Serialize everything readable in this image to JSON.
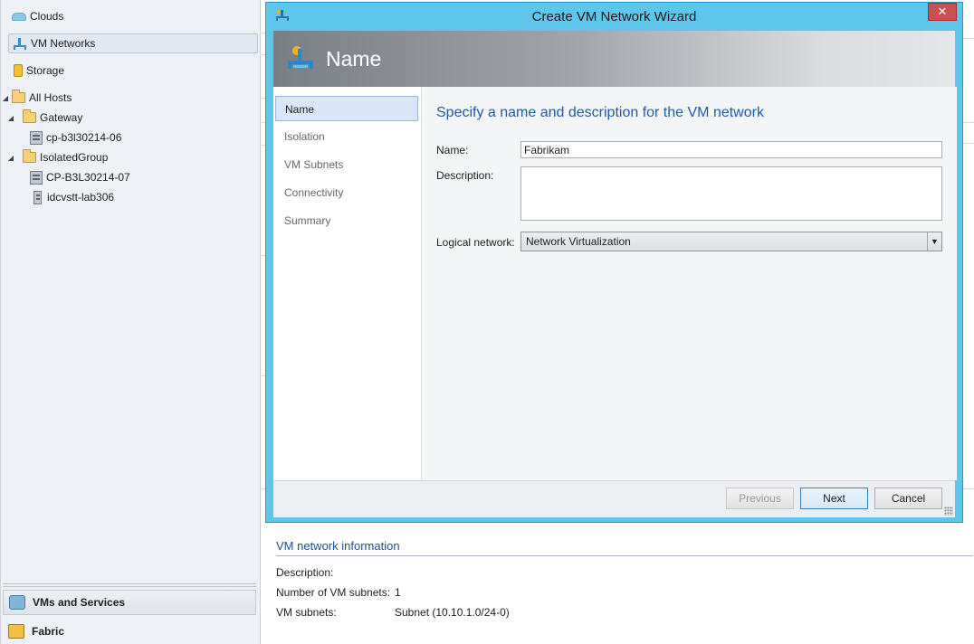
{
  "nav": {
    "clouds": "Clouds",
    "vm_networks": "VM Networks",
    "storage": "Storage",
    "all_hosts": "All Hosts",
    "gateway": "Gateway",
    "gateway_host": "cp-b3l30214-06",
    "isolated_group": "IsolatedGroup",
    "isolated_host1": "CP-B3L30214-07",
    "isolated_host2": "idcvstt-lab306"
  },
  "workspaces": {
    "vms_and_services": "VMs and Services",
    "fabric": "Fabric"
  },
  "details": {
    "title": "VM network information",
    "description_label": "Description:",
    "subnet_count_label": "Number of VM subnets:",
    "subnet_count_value": "1",
    "subnets_label": "VM subnets:",
    "subnets_value": "Subnet (10.10.1.0/24-0)"
  },
  "wizard": {
    "title": "Create VM Network Wizard",
    "close_glyph": "✕",
    "header_title": "Name",
    "steps": [
      "Name",
      "Isolation",
      "VM Subnets",
      "Connectivity",
      "Summary"
    ],
    "active_step": "Name",
    "heading": "Specify a name and description for the VM network",
    "name_label": "Name:",
    "name_value": "Fabrikam",
    "description_label": "Description:",
    "description_value": "",
    "logical_network_label": "Logical network:",
    "logical_network_value": "Network Virtualization",
    "buttons": {
      "previous": "Previous",
      "next": "Next",
      "cancel": "Cancel"
    }
  },
  "colors": {
    "dialog_frame": "#5ec6ea",
    "accent_text": "#1f5ca8",
    "close_button": "#c75050",
    "active_step_bg": "#d9e6f7"
  },
  "icons": {
    "clouds": "cloud-icon",
    "vm_networks": "network-icon",
    "storage": "storage-icon",
    "folders": "folder-icon",
    "hosts": "host-server-icon",
    "wizard": "vm-network-icon"
  }
}
